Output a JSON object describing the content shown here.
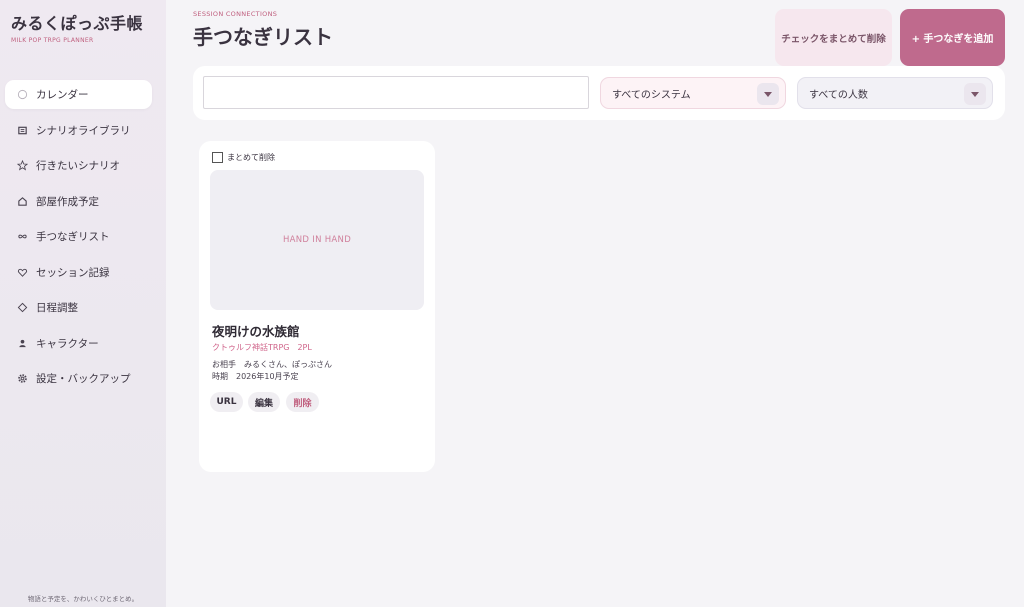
{
  "brand": {
    "title": "みるくぽっぷ手帳",
    "subtitle": "MILK POP TRPG PLANNER"
  },
  "nav": [
    {
      "label": "カレンダー",
      "icon": "circle-icon",
      "active": true
    },
    {
      "label": "シナリオライブラリ",
      "icon": "book-icon"
    },
    {
      "label": "行きたいシナリオ",
      "icon": "star-icon"
    },
    {
      "label": "部屋作成予定",
      "icon": "house-icon"
    },
    {
      "label": "手つなぎリスト",
      "icon": "infinity-icon"
    },
    {
      "label": "セッション記録",
      "icon": "heart-icon"
    },
    {
      "label": "日程調整",
      "icon": "diamond-icon"
    },
    {
      "label": "キャラクター",
      "icon": "person-icon"
    },
    {
      "label": "設定・バックアップ",
      "icon": "gear-icon"
    }
  ],
  "footer": "物語と予定を、かわいくひとまとめ。",
  "header": {
    "subtitle": "SESSION CONNECTIONS",
    "title": "手つなぎリスト",
    "bulk_delete_label": "チェックをまとめて削除",
    "add_label": "+ 手つなぎを追加"
  },
  "filters": {
    "search_value": "",
    "system_selected": "すべてのシステム",
    "people_selected": "すべての人数"
  },
  "card": {
    "checkbox_label": "まとめて削除",
    "thumbnail_text": "HAND IN HAND",
    "title": "夜明けの水族館",
    "system": "クトゥルフ神話TRPG",
    "players": "2PL",
    "partner_key": "お相手",
    "partner_value": "みるくさん、ぽっぷさん",
    "timing_key": "時期",
    "timing_value": "2026年10月予定",
    "actions": {
      "url": "URL",
      "edit": "編集",
      "delete": "削除"
    }
  },
  "colors": {
    "accent": "#bf6a8d",
    "accent_soft": "#f6e7ee",
    "pink_text": "#c0607f",
    "background": "#f5f4f7"
  }
}
